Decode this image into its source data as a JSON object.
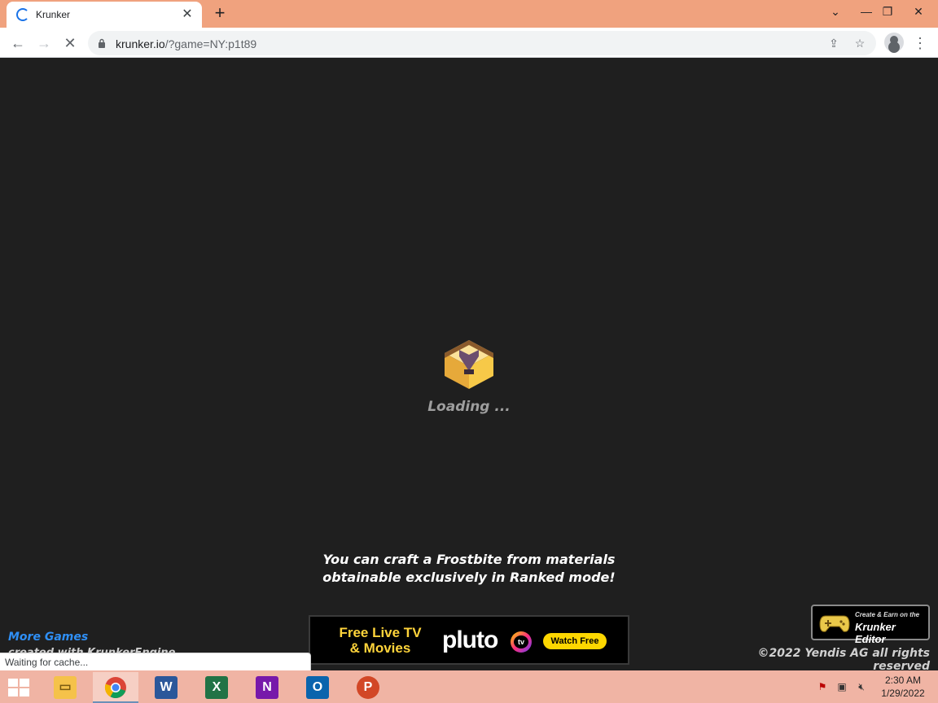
{
  "browser": {
    "tab_title": "Krunker",
    "url_host": "krunker.io",
    "url_path": "/?game=NY:p1t89",
    "status_text": "Waiting for cache..."
  },
  "page": {
    "loading_text": "Loading ...",
    "tip_line1": "You can craft a Frostbite from materials",
    "tip_line2": "obtainable exclusively in Ranked mode!",
    "ad": {
      "line1": "Free Live TV",
      "line2": "& Movies",
      "brand": "pluto",
      "brand_suffix": "tv",
      "cta": "Watch Free"
    },
    "more_games": "More Games",
    "made_with": "created with KrunkerEngine",
    "editor_small": "Create & Earn on the",
    "editor_big": "Krunker Editor",
    "copyright": "©2022 Yendis AG all rights reserved"
  },
  "taskbar": {
    "apps": [
      "File Explorer",
      "Google Chrome",
      "Word",
      "Excel",
      "OneNote",
      "Outlook",
      "PowerPoint"
    ],
    "time": "2:30 AM",
    "date": "1/29/2022"
  },
  "colors": {
    "tabstrip": "#f0a27e",
    "page_bg": "#1f1f1f",
    "taskbar": "#f0b4a4",
    "more_games": "#2f8ff5"
  }
}
